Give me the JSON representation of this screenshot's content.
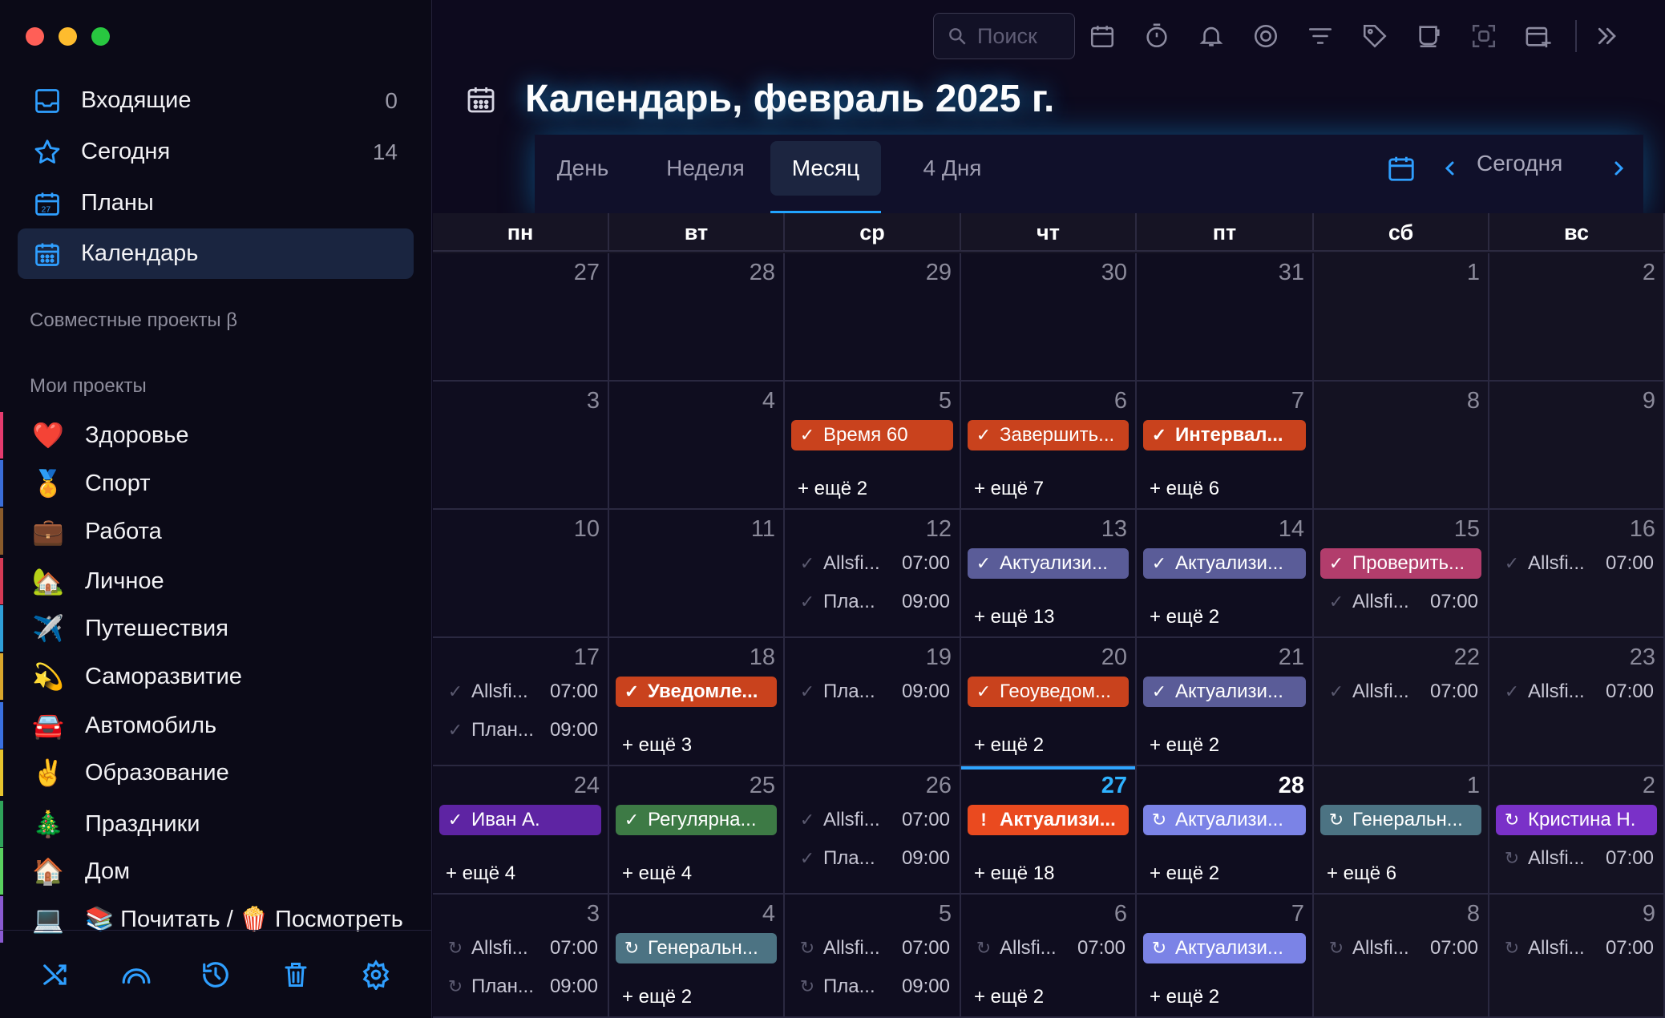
{
  "colors": {
    "accent": "#21a4ff",
    "red": "#c9421d",
    "slate": "#5a5c98",
    "pink": "#b23d6c",
    "violet": "#5e24a3",
    "green": "#3d7a45",
    "lilac": "#7b83e6",
    "grey": "#4c7383",
    "magenta": "#7a31c8",
    "orange": "#ea4a1f"
  },
  "sidebar": {
    "nav": [
      {
        "label": "Входящие",
        "count": "0",
        "icon": "inbox-icon"
      },
      {
        "label": "Сегодня",
        "count": "14",
        "icon": "star-icon"
      },
      {
        "label": "Планы",
        "count": "",
        "icon": "calendar-27-icon"
      },
      {
        "label": "Календарь",
        "count": "",
        "icon": "calendar-grid-icon"
      }
    ],
    "shared_title": "Совместные проекты β",
    "my_projects_title": "Мои проекты",
    "projects": [
      {
        "emoji": "❤️",
        "label": "Здоровье",
        "color": "#e53b6e"
      },
      {
        "emoji": "🏅",
        "label": "Спорт",
        "color": "#3a6dd8"
      },
      {
        "emoji": "💼",
        "label": "Работа",
        "color": "#8a5b2b"
      },
      {
        "emoji": "🏡",
        "label": "Личное",
        "color": "#d63a55"
      },
      {
        "emoji": "✈️",
        "label": "Путешествия",
        "color": "#2f9fd8"
      },
      {
        "emoji": "💫",
        "label": "Саморазвитие",
        "color": "#d9a62c"
      },
      {
        "emoji": "🚘",
        "label": "Автомобиль",
        "color": "#3a70e0"
      },
      {
        "emoji": "✌️",
        "label": "Образование",
        "color": "#e7c42e"
      },
      {
        "emoji": "🎄",
        "label": "Праздники",
        "color": "#2fa35a"
      },
      {
        "emoji": "🏠",
        "label": "Дом",
        "color": "#5ad15f"
      },
      {
        "emoji": "💻",
        "label": "📚 Почитать / 🍿 Посмотреть",
        "color": "#8a5ad1"
      }
    ],
    "bottom_icons": [
      "shuffle-icon",
      "signal-arc-icon",
      "history-icon",
      "trash-icon",
      "settings-gear-icon"
    ]
  },
  "toolbar": {
    "search_placeholder": "Поиск",
    "icons": [
      "calendar-icon",
      "timer-icon",
      "bell-icon",
      "focus-target-icon",
      "filter-icon",
      "tag-icon",
      "cup-icon",
      "screenshot-icon",
      "add-calendar-icon"
    ]
  },
  "header": {
    "title": "Календарь, февраль 2025 г."
  },
  "views": {
    "tabs": [
      "День",
      "Неделя",
      "Месяц",
      "4 Дня"
    ],
    "active": "Месяц",
    "today": "Сегодня"
  },
  "weekdays": [
    "пн",
    "вт",
    "ср",
    "чт",
    "пт",
    "сб",
    "вс"
  ],
  "weeks": [
    [
      {
        "d": "27",
        "ev": []
      },
      {
        "d": "28",
        "ev": []
      },
      {
        "d": "29",
        "ev": []
      },
      {
        "d": "30",
        "ev": []
      },
      {
        "d": "31",
        "ev": []
      },
      {
        "d": "1",
        "ev": []
      },
      {
        "d": "2",
        "ev": []
      }
    ],
    [
      {
        "d": "3",
        "ev": []
      },
      {
        "d": "4",
        "ev": []
      },
      {
        "d": "5",
        "ev": [
          {
            "t": "Время 60",
            "c": "red",
            "i": "✓"
          }
        ],
        "more": "+ ещё 2"
      },
      {
        "d": "6",
        "ev": [
          {
            "t": "Завершить...",
            "c": "red",
            "i": "✓"
          }
        ],
        "more": "+ ещё 7"
      },
      {
        "d": "7",
        "ev": [
          {
            "t": "Интервал...",
            "c": "red",
            "i": "✓",
            "b": true
          }
        ],
        "more": "+ ещё 6"
      },
      {
        "d": "8",
        "ev": []
      },
      {
        "d": "9",
        "ev": []
      }
    ],
    [
      {
        "d": "10",
        "ev": []
      },
      {
        "d": "11",
        "ev": []
      },
      {
        "d": "12",
        "ev": [
          {
            "t": "Allsfi...",
            "tm": "07:00",
            "c": "plain",
            "i": "✓"
          },
          {
            "t": "Пла...",
            "tm": "09:00",
            "c": "plain",
            "i": "✓"
          }
        ]
      },
      {
        "d": "13",
        "ev": [
          {
            "t": "Актуализи...",
            "c": "slate",
            "i": "✓"
          }
        ],
        "more": "+ ещё 13"
      },
      {
        "d": "14",
        "ev": [
          {
            "t": "Актуализи...",
            "c": "slate",
            "i": "✓"
          }
        ],
        "more": "+ ещё 2"
      },
      {
        "d": "15",
        "ev": [
          {
            "t": "Проверить...",
            "c": "pink",
            "i": "✓"
          },
          {
            "t": "Allsfi...",
            "tm": "07:00",
            "c": "plain",
            "i": "✓"
          }
        ]
      },
      {
        "d": "16",
        "ev": [
          {
            "t": "Allsfi...",
            "tm": "07:00",
            "c": "plain",
            "i": "✓"
          }
        ]
      }
    ],
    [
      {
        "d": "17",
        "ev": [
          {
            "t": "Allsfi...",
            "tm": "07:00",
            "c": "plain",
            "i": "✓"
          },
          {
            "t": "План...",
            "tm": "09:00",
            "c": "plain",
            "i": "✓"
          }
        ]
      },
      {
        "d": "18",
        "ev": [
          {
            "t": "Уведомле...",
            "c": "red",
            "i": "✓",
            "b": true
          }
        ],
        "more": "+ ещё 3"
      },
      {
        "d": "19",
        "ev": [
          {
            "t": "Пла...",
            "tm": "09:00",
            "c": "plain",
            "i": "✓"
          }
        ]
      },
      {
        "d": "20",
        "ev": [
          {
            "t": "Геоуведом...",
            "c": "red",
            "i": "✓"
          }
        ],
        "more": "+ ещё 2"
      },
      {
        "d": "21",
        "ev": [
          {
            "t": "Актуализи...",
            "c": "slate",
            "i": "✓"
          }
        ],
        "more": "+ ещё 2"
      },
      {
        "d": "22",
        "ev": [
          {
            "t": "Allsfi...",
            "tm": "07:00",
            "c": "plain",
            "i": "✓"
          }
        ]
      },
      {
        "d": "23",
        "ev": [
          {
            "t": "Allsfi...",
            "tm": "07:00",
            "c": "plain",
            "i": "✓"
          }
        ]
      }
    ],
    [
      {
        "d": "24",
        "ev": [
          {
            "t": "Иван А.",
            "c": "violet",
            "i": "✓"
          }
        ],
        "more": "+ ещё 4"
      },
      {
        "d": "25",
        "ev": [
          {
            "t": "Регулярна...",
            "c": "green",
            "i": "✓"
          }
        ],
        "more": "+ ещё 4"
      },
      {
        "d": "26",
        "ev": [
          {
            "t": "Allsfi...",
            "tm": "07:00",
            "c": "plain",
            "i": "✓"
          },
          {
            "t": "Пла...",
            "tm": "09:00",
            "c": "plain",
            "i": "✓"
          }
        ]
      },
      {
        "d": "27",
        "today": true,
        "ev": [
          {
            "t": "Актуализи...",
            "c": "orange",
            "i": "!",
            "b": true
          }
        ],
        "more": "+ ещё 18"
      },
      {
        "d": "28",
        "bright": true,
        "ev": [
          {
            "t": "Актуализи...",
            "c": "lilac",
            "i": "↻"
          }
        ],
        "more": "+ ещё 2"
      },
      {
        "d": "1",
        "ev": [
          {
            "t": "Генеральн...",
            "c": "grey",
            "i": "↻"
          }
        ],
        "more": "+ ещё 6"
      },
      {
        "d": "2",
        "ev": [
          {
            "t": "Кристина Н.",
            "c": "magenta",
            "i": "↻"
          },
          {
            "t": "Allsfi...",
            "tm": "07:00",
            "c": "plain",
            "i": "↻"
          }
        ]
      }
    ],
    [
      {
        "d": "3",
        "ev": [
          {
            "t": "Allsfi...",
            "tm": "07:00",
            "c": "plain",
            "i": "↻"
          },
          {
            "t": "План...",
            "tm": "09:00",
            "c": "plain",
            "i": "↻"
          }
        ]
      },
      {
        "d": "4",
        "ev": [
          {
            "t": "Генеральн...",
            "c": "grey",
            "i": "↻"
          }
        ],
        "more": "+ ещё 2"
      },
      {
        "d": "5",
        "ev": [
          {
            "t": "Allsfi...",
            "tm": "07:00",
            "c": "plain",
            "i": "↻"
          },
          {
            "t": "Пла...",
            "tm": "09:00",
            "c": "plain",
            "i": "↻"
          }
        ]
      },
      {
        "d": "6",
        "ev": [
          {
            "t": "Allsfi...",
            "tm": "07:00",
            "c": "plain",
            "i": "↻"
          }
        ],
        "more": "+ ещё 2"
      },
      {
        "d": "7",
        "ev": [
          {
            "t": "Актуализи...",
            "c": "lilac",
            "i": "↻"
          }
        ],
        "more": "+ ещё 2"
      },
      {
        "d": "8",
        "ev": [
          {
            "t": "Allsfi...",
            "tm": "07:00",
            "c": "plain",
            "i": "↻"
          }
        ]
      },
      {
        "d": "9",
        "ev": [
          {
            "t": "Allsfi...",
            "tm": "07:00",
            "c": "plain",
            "i": "↻"
          }
        ]
      }
    ]
  ]
}
